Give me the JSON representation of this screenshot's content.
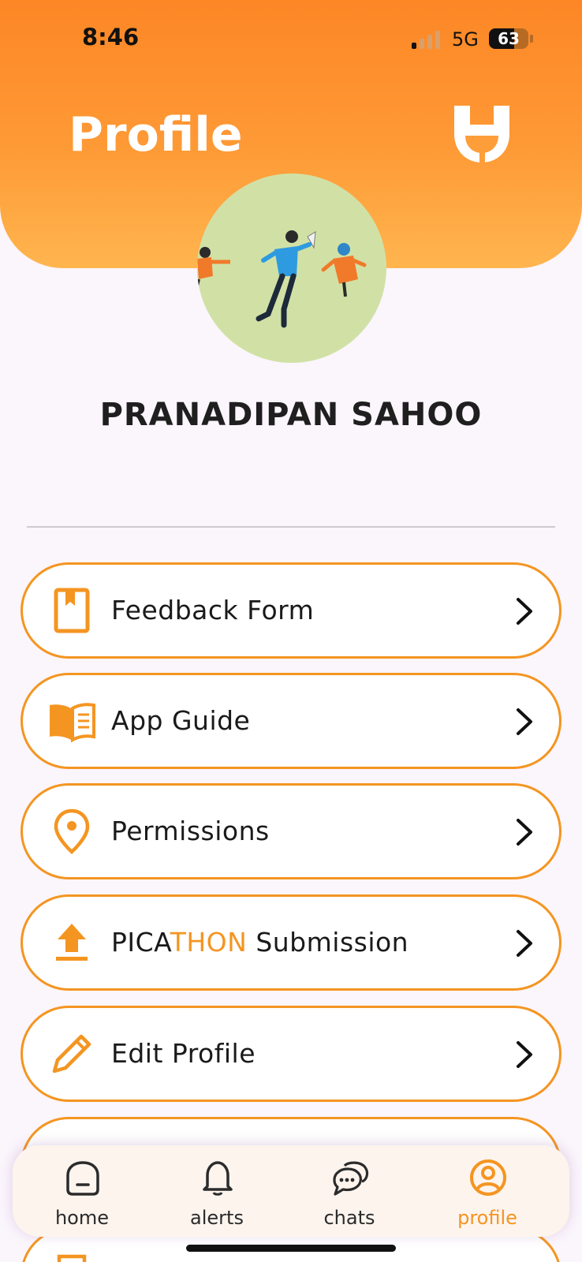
{
  "status_bar": {
    "time": "8:46",
    "network": "5G",
    "battery_level": "63",
    "battery_fraction": 0.63
  },
  "header": {
    "title": "Profile",
    "logo_icon": "u-plug-logo-icon"
  },
  "profile": {
    "name": "PRANADIPAN SAHOO",
    "avatar_icon": "people-illustration-avatar"
  },
  "menu": [
    {
      "icon": "bookmark-book-icon",
      "label": "Feedback Form"
    },
    {
      "icon": "open-book-icon",
      "label": "App Guide"
    },
    {
      "icon": "location-pin-icon",
      "label": "Permissions"
    },
    {
      "icon": "upload-icon",
      "label_part1": "PICA",
      "label_part2": "THON",
      "label_part3": " Submission"
    },
    {
      "icon": "pencil-icon",
      "label": "Edit Profile"
    }
  ],
  "nav": {
    "items": [
      {
        "icon": "home-icon",
        "label": "home"
      },
      {
        "icon": "bell-icon",
        "label": "alerts"
      },
      {
        "icon": "chat-bubbles-icon",
        "label": "chats"
      },
      {
        "icon": "profile-icon",
        "label": "profile"
      }
    ],
    "active": "profile"
  },
  "colors": {
    "accent": "#f49521",
    "header_top": "#fd8625",
    "header_bottom": "#ffb54f",
    "background": "#fbf5fc"
  }
}
